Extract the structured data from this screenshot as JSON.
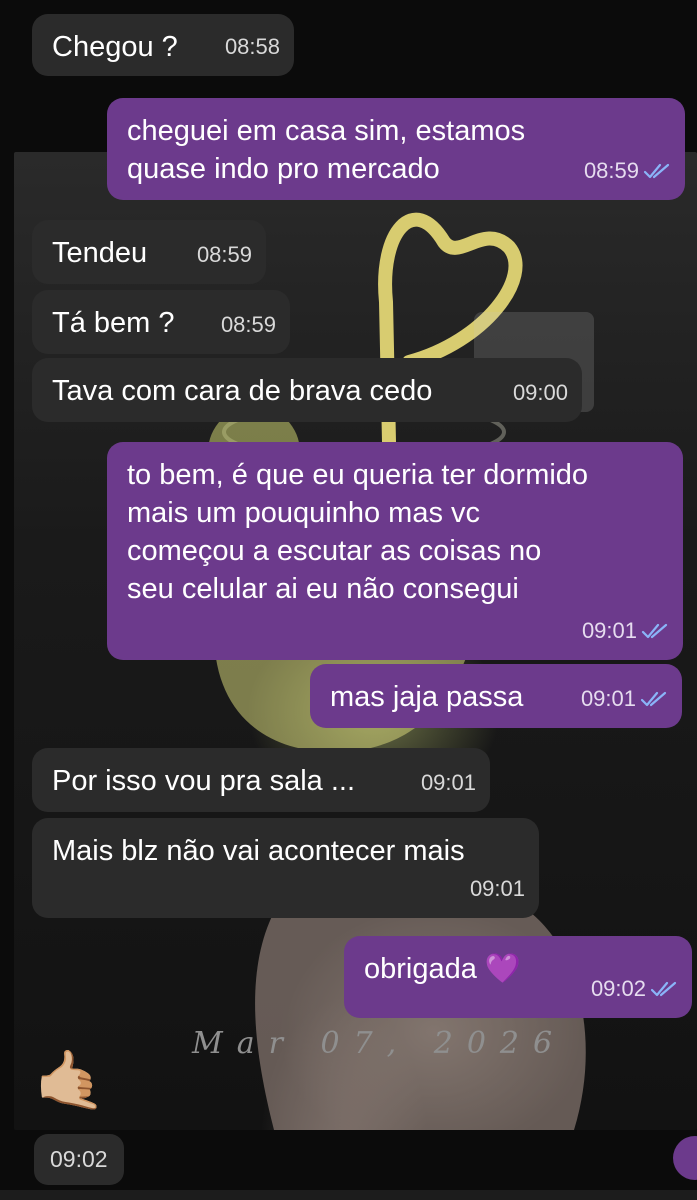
{
  "theme": {
    "incoming_bubble": "#2b2b2b",
    "outgoing_bubble": "#6c3a8c",
    "tick_color": "#8ab4f8"
  },
  "messages": [
    {
      "dir": "in",
      "text": "Chegou ?",
      "time": "08:58"
    },
    {
      "dir": "out",
      "text": "cheguei em casa sim, estamos\nquase indo pro mercado",
      "time": "08:59",
      "status": "read"
    },
    {
      "dir": "in",
      "text": "Tendeu",
      "time": "08:59"
    },
    {
      "dir": "in",
      "text": "Tá bem ?",
      "time": "08:59"
    },
    {
      "dir": "in",
      "text": "Tava com cara de brava cedo",
      "time": "09:00"
    },
    {
      "dir": "out",
      "text": "to bem, é que eu queria ter dormido\nmais um pouquinho mas vc\ncomeçou a escutar as coisas no\nseu celular ai eu não consegui",
      "time": "09:01",
      "status": "read"
    },
    {
      "dir": "out",
      "text": "mas jaja passa",
      "time": "09:01",
      "status": "read"
    },
    {
      "dir": "in",
      "text": "Por isso vou pra sala ...",
      "time": "09:01"
    },
    {
      "dir": "in",
      "text": "Mais blz não vai acontecer mais",
      "time": "09:01"
    },
    {
      "dir": "out",
      "text": "obrigada 💜",
      "time": "09:02",
      "status": "read"
    }
  ],
  "shared_photo": {
    "date_stamp": "Mar 07, 2026"
  },
  "reaction": {
    "emoji": "🤙🏼",
    "icon": "call-me-hand-icon"
  },
  "last_time": "09:02"
}
